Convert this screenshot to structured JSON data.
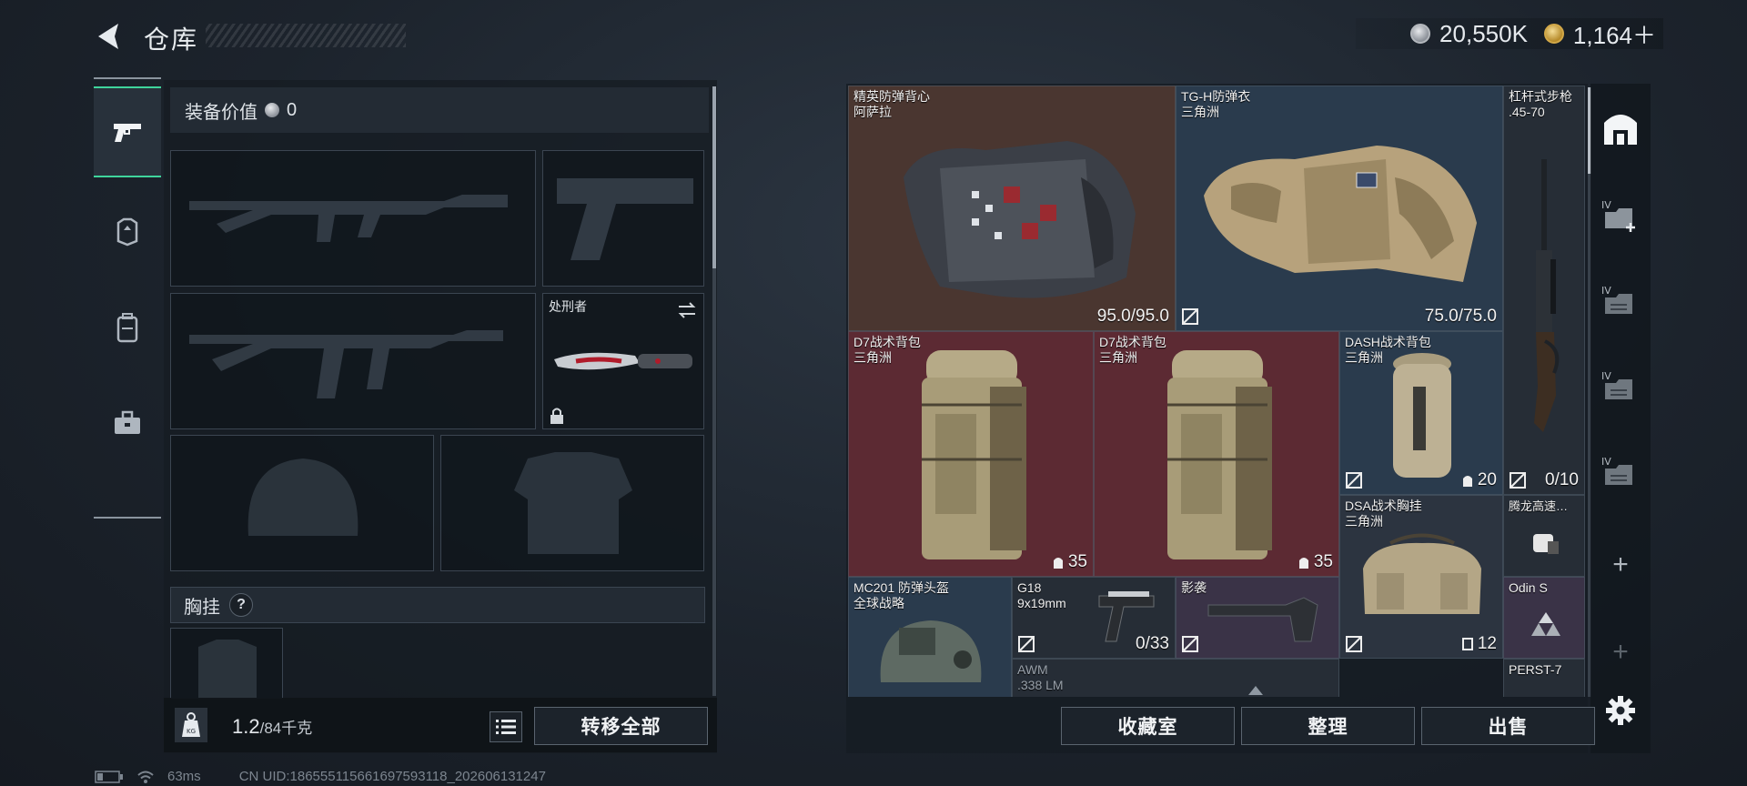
{
  "header": {
    "title": "仓库",
    "currencies": [
      {
        "icon": "silver-coin-icon",
        "value": "20,550K"
      },
      {
        "icon": "gold-coin-icon",
        "value": "1,164＋"
      }
    ]
  },
  "left_nav": [
    {
      "icon": "pistol-icon",
      "active": true
    },
    {
      "icon": "armor-vest-icon",
      "active": false
    },
    {
      "icon": "backpack-icon",
      "active": false
    },
    {
      "icon": "toolbox-icon",
      "active": false
    }
  ],
  "loadout": {
    "equip_value_label": "装备价值",
    "equip_value": "0",
    "melee_slot_label": "处刑者",
    "chest_rig_label": "胸挂",
    "help_label": "?",
    "weight_current": "1.2",
    "weight_max": "/84千克",
    "transfer_all": "转移全部"
  },
  "stash": {
    "items": [
      {
        "name": "精英防弹背心",
        "sub": "阿萨拉",
        "stat": "95.0/95.0"
      },
      {
        "name": "TG-H防弹衣",
        "sub": "三角洲",
        "stat": "75.0/75.0"
      },
      {
        "name": "杠杆式步枪",
        "sub": ".45-70",
        "stat": "0/10"
      },
      {
        "name": "D7战术背包",
        "sub": "三角洲",
        "stat": "35"
      },
      {
        "name": "D7战术背包",
        "sub": "三角洲",
        "stat": "35"
      },
      {
        "name": "DASH战术背包",
        "sub": "三角洲",
        "stat": "20"
      },
      {
        "name": "DSA战术胸挂",
        "sub": "三角洲",
        "stat": "12"
      },
      {
        "name": "腾龙高速…",
        "sub": "",
        "stat": ""
      },
      {
        "name": "MC201 防弹头盔",
        "sub": "全球战略",
        "stat": ""
      },
      {
        "name": "G18",
        "sub": "9x19mm",
        "stat": "0/33"
      },
      {
        "name": "影袭",
        "sub": "",
        "stat": ""
      },
      {
        "name": "Odin S",
        "sub": "",
        "stat": ""
      },
      {
        "name": "AWM",
        "sub": ".338 LM",
        "stat": ""
      },
      {
        "name": "PERST-7",
        "sub": "",
        "stat": ""
      }
    ],
    "sidebar_tier": "IV",
    "sidebar_plus": "+"
  },
  "bottom_buttons": {
    "collection": "收藏室",
    "organize": "整理",
    "sell": "出售"
  },
  "status": {
    "ping": "63ms",
    "uid": "CN UID:18655511566169759311​8_202606131247"
  }
}
